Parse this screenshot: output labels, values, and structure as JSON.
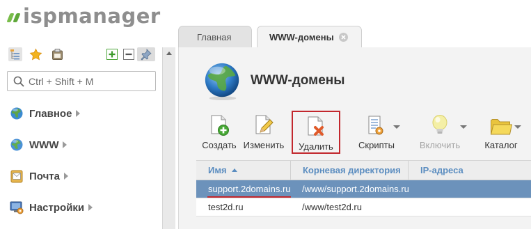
{
  "app": {
    "logo_text": "ispmanager"
  },
  "sidebar": {
    "search_placeholder": "Ctrl + Shift + M",
    "toolbar_icons": [
      "tree-view-icon",
      "star-icon",
      "clipboard-icon",
      "expand-plus-icon",
      "collapse-minus-icon",
      "pin-icon"
    ],
    "items": [
      {
        "label": "Главное",
        "icon": "globe-home-icon"
      },
      {
        "label": "WWW",
        "icon": "globe-icon"
      },
      {
        "label": "Почта",
        "icon": "mail-icon"
      },
      {
        "label": "Настройки",
        "icon": "settings-monitor-icon"
      }
    ]
  },
  "tabs": [
    {
      "label": "Главная",
      "active": false
    },
    {
      "label": "WWW-домены",
      "active": true,
      "closable": true
    }
  ],
  "page": {
    "title": "WWW-домены",
    "icon": "globe-icon"
  },
  "toolbar": {
    "create": "Создать",
    "edit": "Изменить",
    "delete": "Удалить",
    "scripts": "Скрипты",
    "enable": "Включить",
    "catalog": "Каталог"
  },
  "table": {
    "columns": [
      "Имя",
      "Корневая директория",
      "IP-адреса"
    ],
    "sorted_column": "Имя",
    "rows": [
      {
        "name": "support.2domains.ru",
        "root": "/www/support.2domains.ru",
        "ip": "",
        "selected": true
      },
      {
        "name": "test2d.ru",
        "root": "/www/test2d.ru",
        "ip": "",
        "selected": false
      }
    ]
  },
  "colors": {
    "accent_green": "#5fa83a",
    "selected_row": "#6c92bb",
    "highlight_red": "#c2272d",
    "header_text": "#5b8dc0"
  }
}
